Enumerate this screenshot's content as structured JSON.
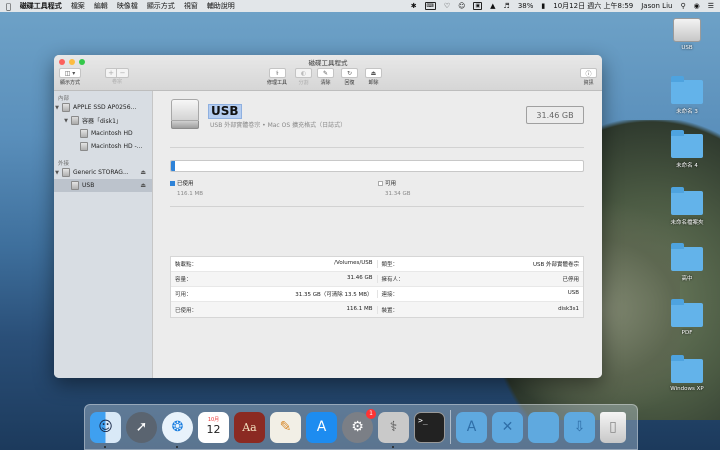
{
  "menubar": {
    "app_name": "磁碟工具程式",
    "items": [
      "檔案",
      "編輯",
      "映像檔",
      "顯示方式",
      "視窗",
      "輔助說明"
    ],
    "battery": "38%",
    "datetime": "10月12日 週六 上午8:59",
    "user": "Jason Liu"
  },
  "window": {
    "title": "磁碟工具程式",
    "toolbar": {
      "view_label": "顯示方式",
      "volume_label": "卷宗",
      "first_aid": "修理工具",
      "partition": "分割",
      "erase": "清除",
      "restore": "回復",
      "unmount": "卸除",
      "info": "資訊"
    }
  },
  "sidebar": {
    "internal_header": "內部",
    "external_header": "外接",
    "items": [
      {
        "label": "APPLE SSD AP0256..."
      },
      {
        "label": "容器「disk1」"
      },
      {
        "label": "Macintosh HD"
      },
      {
        "label": "Macintosh HD -..."
      },
      {
        "label": "Generic STORAG..."
      },
      {
        "label": "USB"
      }
    ]
  },
  "volume": {
    "name": "USB",
    "subtitle": "USB 外部實體卷宗 • Mac OS 擴充格式（日誌式）",
    "capacity": "31.46 GB",
    "usage_fraction": 0.0037
  },
  "legend": {
    "used_label": "已使用",
    "used_value": "116.1 MB",
    "free_label": "可用",
    "free_value": "31.34 GB"
  },
  "colors": {
    "used": "#2f83d8",
    "free": "#ffffff"
  },
  "info_rows": [
    {
      "lk": "裝載點：",
      "lv": "/Volumes/USB",
      "rk": "類型：",
      "rv": "USB 外部實體卷宗"
    },
    {
      "lk": "容量：",
      "lv": "31.46 GB",
      "rk": "擁有人：",
      "rv": "已停用"
    },
    {
      "lk": "可用：",
      "lv": "31.35 GB（可清除 13.5 MB）",
      "rk": "連接：",
      "rv": "USB"
    },
    {
      "lk": "已使用：",
      "lv": "116.1 MB",
      "rk": "裝置：",
      "rv": "disk3s1"
    }
  ],
  "desktop_icons": [
    {
      "label": "USB",
      "icon": "drive-icon"
    },
    {
      "label": "未命名 3",
      "icon": "folder-icon"
    },
    {
      "label": "未命名 4",
      "icon": "folder-icon"
    },
    {
      "label": "未命名檔案夾",
      "icon": "folder-icon"
    },
    {
      "label": "高中",
      "icon": "folder-icon"
    },
    {
      "label": "PDF",
      "icon": "folder-icon"
    },
    {
      "label": "Windows XP",
      "icon": "folder-icon"
    }
  ],
  "dock": {
    "calendar_day": "12",
    "calendar_month": "10月",
    "settings_badge": "1"
  }
}
